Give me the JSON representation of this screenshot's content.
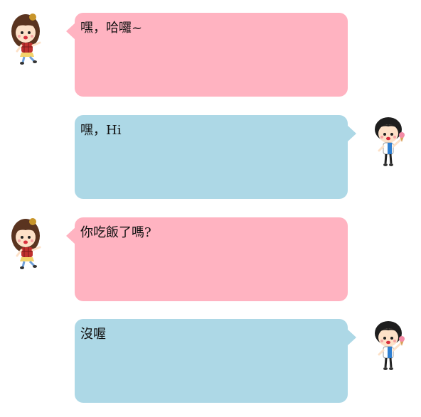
{
  "messages": [
    {
      "side": "left",
      "sender": "girl",
      "text": "嘿，哈囉~"
    },
    {
      "side": "right",
      "sender": "boy",
      "text": "嘿，Hi"
    },
    {
      "side": "left",
      "sender": "girl",
      "text": "你吃飯了嗎?"
    },
    {
      "side": "right",
      "sender": "boy",
      "text": "沒喔"
    }
  ],
  "colors": {
    "left_bubble": "#ffb3c1",
    "right_bubble": "#add8e6"
  },
  "icons": {
    "girl_avatar": "cartoon-girl-avatar-icon",
    "boy_avatar": "cartoon-boy-avatar-icon"
  }
}
